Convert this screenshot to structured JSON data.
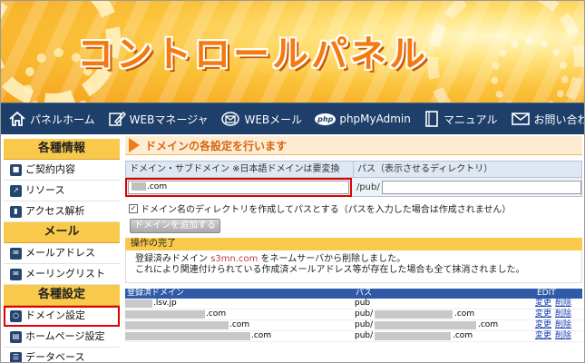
{
  "banner": {
    "title": "コントロールパネル"
  },
  "nav": [
    {
      "label": "パネルホーム",
      "icon": "home-icon"
    },
    {
      "label": "WEBマネージャ",
      "icon": "edit-icon"
    },
    {
      "label": "WEBメール",
      "icon": "mail-globe-icon"
    },
    {
      "label": "phpMyAdmin",
      "icon": "php-icon"
    },
    {
      "label": "マニュアル",
      "icon": "book-icon"
    },
    {
      "label": "お問い合わせ",
      "icon": "envelope-icon"
    }
  ],
  "sidebar": {
    "sections": [
      {
        "title": "各種情報",
        "items": [
          {
            "label": "ご契約内容",
            "icon": "user-icon"
          },
          {
            "label": "リソース",
            "icon": "chart-icon"
          },
          {
            "label": "アクセス解析",
            "icon": "bar-chart-icon"
          }
        ]
      },
      {
        "title": "メール",
        "items": [
          {
            "label": "メールアドレス",
            "icon": "mail-icon"
          },
          {
            "label": "メーリングリスト",
            "icon": "mailing-list-icon"
          }
        ]
      },
      {
        "title": "各種設定",
        "items": [
          {
            "label": "ドメイン設定",
            "icon": "globe-icon",
            "active": true
          },
          {
            "label": "ホームページ設定",
            "icon": "homepage-icon"
          },
          {
            "label": "データベース",
            "icon": "database-icon"
          }
        ]
      }
    ]
  },
  "main": {
    "title": "ドメインの各設定を行います",
    "form": {
      "domain_header": "ドメイン・サブドメイン ※日本語ドメインは要変換",
      "path_header": "パス（表示させるディレクトリ）",
      "domain_value": ".com",
      "path_prefix": "/pub/",
      "checkbox_label": "ドメイン名のディレクトリを作成してパスとする（パスを入力した場合は作成されません）",
      "add_button": "ドメインを追加する"
    },
    "done": {
      "title": "操作の完了",
      "line1_prefix": "登録済みドメイン ",
      "line1_domain": "s3mn.com",
      "line1_suffix": " をネームサーバから削除しました。",
      "line2": "これにより関連付けられている作成済メールアドレス等が存在した場合も全て抹消されました。"
    },
    "list": {
      "headers": {
        "domain": "登録済ドメイン",
        "path": "パス",
        "edit": "EDIT"
      },
      "rows": [
        {
          "domain": ".lsv.jp",
          "path": "pub",
          "edit": "変更",
          "delete": "削除"
        },
        {
          "domain": ".com",
          "path": "pub/",
          "path_suffix": ".com",
          "edit": "変更",
          "delete": "削除"
        },
        {
          "domain": ".com",
          "path": "pub/",
          "path_suffix": ".com",
          "edit": "変更",
          "delete": "削除"
        },
        {
          "domain": ".com",
          "path": "pub/",
          "path_suffix": ".com",
          "edit": "変更",
          "delete": "削除"
        }
      ]
    }
  }
}
